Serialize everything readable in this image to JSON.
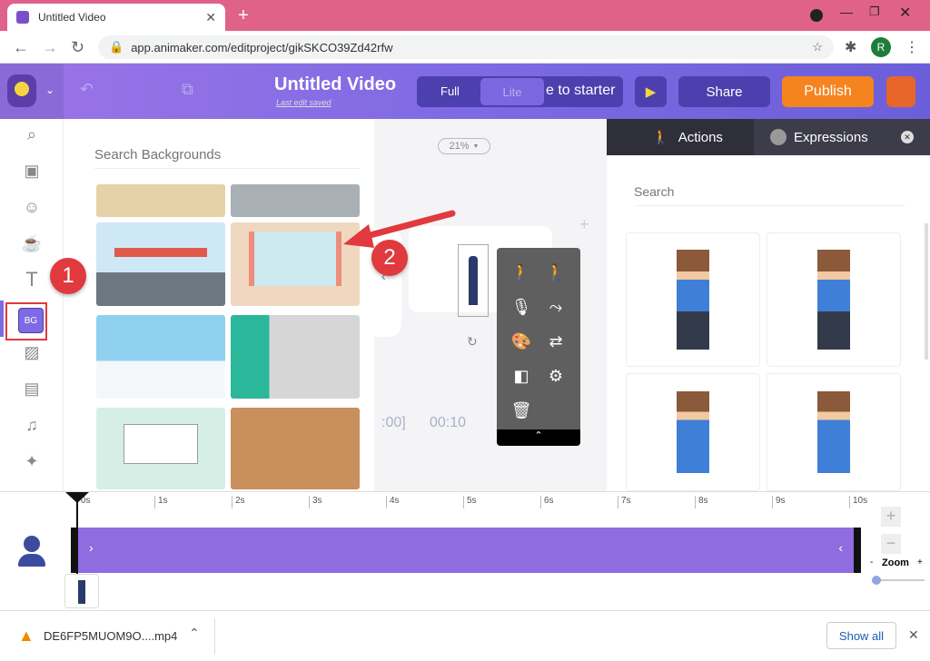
{
  "browser": {
    "tab_title": "Untitled Video",
    "url": "app.animaker.com/editproject/gikSKCO39Zd42rfw",
    "profile_initial": "R"
  },
  "header": {
    "title": "Untitled Video",
    "subtitle": "Last edit saved",
    "mode_full": "Full",
    "mode_lite": "Lite",
    "starter_label": "e to starter",
    "share": "Share",
    "publish": "Publish"
  },
  "rail": {
    "bg_label": "BG"
  },
  "bg_panel": {
    "search_placeholder": "Search Backgrounds"
  },
  "canvas": {
    "zoom": "21%",
    "time_start": ":00]",
    "time_end": "00:10"
  },
  "right_panel": {
    "tab_actions": "Actions",
    "tab_expressions": "Expressions",
    "search_placeholder": "Search"
  },
  "timeline": {
    "ticks": [
      "0s",
      "1s",
      "2s",
      "3s",
      "4s",
      "5s",
      "6s",
      "7s",
      "8s",
      "9s",
      "10s"
    ],
    "zoom_label": "Zoom",
    "zoom_minus": "-",
    "zoom_plus": "+"
  },
  "annotations": {
    "badge1": "1",
    "badge2": "2"
  },
  "downloads": {
    "file": "DE6FP5MUOM9O....mp4",
    "show_all": "Show all"
  },
  "colors": {
    "accent": "#7e6ae4",
    "publish": "#f5841f",
    "annotation": "#e0393e"
  }
}
